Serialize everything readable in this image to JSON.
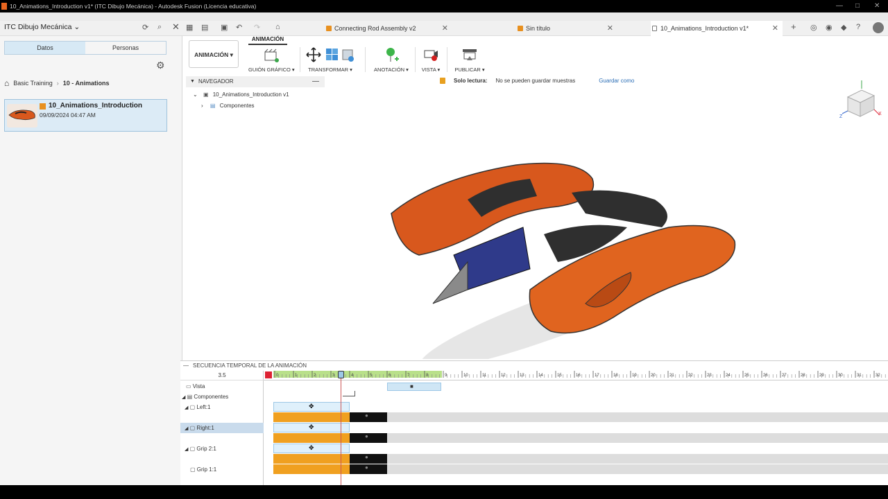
{
  "window": {
    "title": "10_Animations_Introduction v1* (ITC Dibujo Mecánica) - Autodesk Fusion (Licencia educativa)"
  },
  "hub": {
    "name": "ITC Dibujo Mecánica"
  },
  "tabs": [
    {
      "label": "Connecting Rod Assembly v2",
      "active": false
    },
    {
      "label": "Sin título",
      "active": false
    },
    {
      "label": "10_Animations_Introduction v1*",
      "active": true
    }
  ],
  "data_panel": {
    "tabs": [
      "Datos",
      "Personas"
    ],
    "breadcrumb": [
      "Basic Training",
      "10 - Animations"
    ],
    "file": {
      "name": "10_Animations_Introduction",
      "date": "09/09/2024 04:47 AM"
    }
  },
  "toolbar": {
    "workspace": "ANIMACIÓN",
    "active_tab": "ANIMACIÓN",
    "groups": [
      {
        "label": "GUIÓN GRÁFICO ▾"
      },
      {
        "label": "TRANSFORMAR ▾"
      },
      {
        "label": "ANOTACIÓN ▾"
      },
      {
        "label": "VISTA ▾"
      },
      {
        "label": "PUBLICAR ▾"
      }
    ]
  },
  "browser": {
    "header": "NAVEGADOR",
    "root": "10_Animations_Introduction v1",
    "child": "Componentes"
  },
  "banner": {
    "title": "Solo lectura:",
    "message": "No se pueden guardar muestras",
    "action": "Guardar como"
  },
  "timeline": {
    "header": "SECUENCIA TEMPORAL DE LA ANIMACIÓN",
    "current_time": "3.5",
    "playhead_seconds": 3.5,
    "ruler_ticks": [
      "0",
      "1",
      "2",
      "3",
      "4",
      "5",
      "6",
      "7",
      "8",
      "9",
      "10",
      "11",
      "12",
      "13",
      "14",
      "15",
      "16",
      "17",
      "18",
      "19",
      "20",
      "21",
      "22",
      "23",
      "24",
      "25",
      "26",
      "27",
      "28",
      "29",
      "30",
      "31",
      "32"
    ],
    "rows": [
      {
        "label": "Vista",
        "selected": false
      },
      {
        "label": "Componentes",
        "selected": false
      },
      {
        "label": "Left:1",
        "selected": false
      },
      {
        "label": "Right:1",
        "selected": true
      },
      {
        "label": "Grip 2:1",
        "selected": false
      },
      {
        "label": "Grip 1:1",
        "selected": false
      }
    ]
  },
  "colors": {
    "accent": "#e8651f",
    "selection": "#c9dbec",
    "ruler_green": "#b9e08a",
    "action_bar": "#f0a020"
  }
}
